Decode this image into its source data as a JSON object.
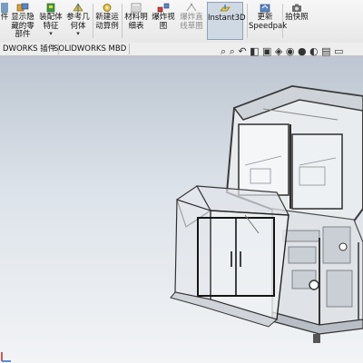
{
  "ribbon": {
    "buttons": [
      {
        "label_lines": [
          "件"
        ],
        "has_caret": false
      },
      {
        "label_lines": [
          "显示隐",
          "藏的零",
          "部件"
        ],
        "has_caret": false
      },
      {
        "label_lines": [
          "装配体",
          "特征"
        ],
        "has_caret": true
      },
      {
        "label_lines": [
          "参考几",
          "何体"
        ],
        "has_caret": true
      },
      {
        "label_lines": [
          "新建运",
          "动算例"
        ],
        "has_caret": false
      },
      {
        "label_lines": [
          "材料明",
          "细表"
        ],
        "has_caret": false
      },
      {
        "label_lines": [
          "爆炸视",
          "图"
        ],
        "has_caret": false
      },
      {
        "label_lines": [
          "爆炸直",
          "线草图"
        ],
        "has_caret": false,
        "disabled": true
      },
      {
        "label_lines": [
          "Instant3D"
        ],
        "has_caret": false,
        "selected": true
      },
      {
        "label_lines": [
          "更新",
          "Speedpak"
        ],
        "has_caret": false
      },
      {
        "label_lines": [
          "拍快照"
        ],
        "has_caret": false
      }
    ]
  },
  "tabs": [
    "DWORKS 插件",
    "SOLIDWORKS MBD"
  ],
  "hud_icons": [
    "zoom-to-fit-icon",
    "zoom-area-icon",
    "previous-view-icon",
    "section-view-icon",
    "view-orientation-icon",
    "display-style-icon",
    "hide-show-icon",
    "edit-appearance-icon",
    "scene-icon",
    "view-settings-icon",
    "render-icon"
  ],
  "colors": {
    "accent": "#2a6fc9",
    "frame": "#3a3a3a",
    "panel": "#e9ecef"
  }
}
